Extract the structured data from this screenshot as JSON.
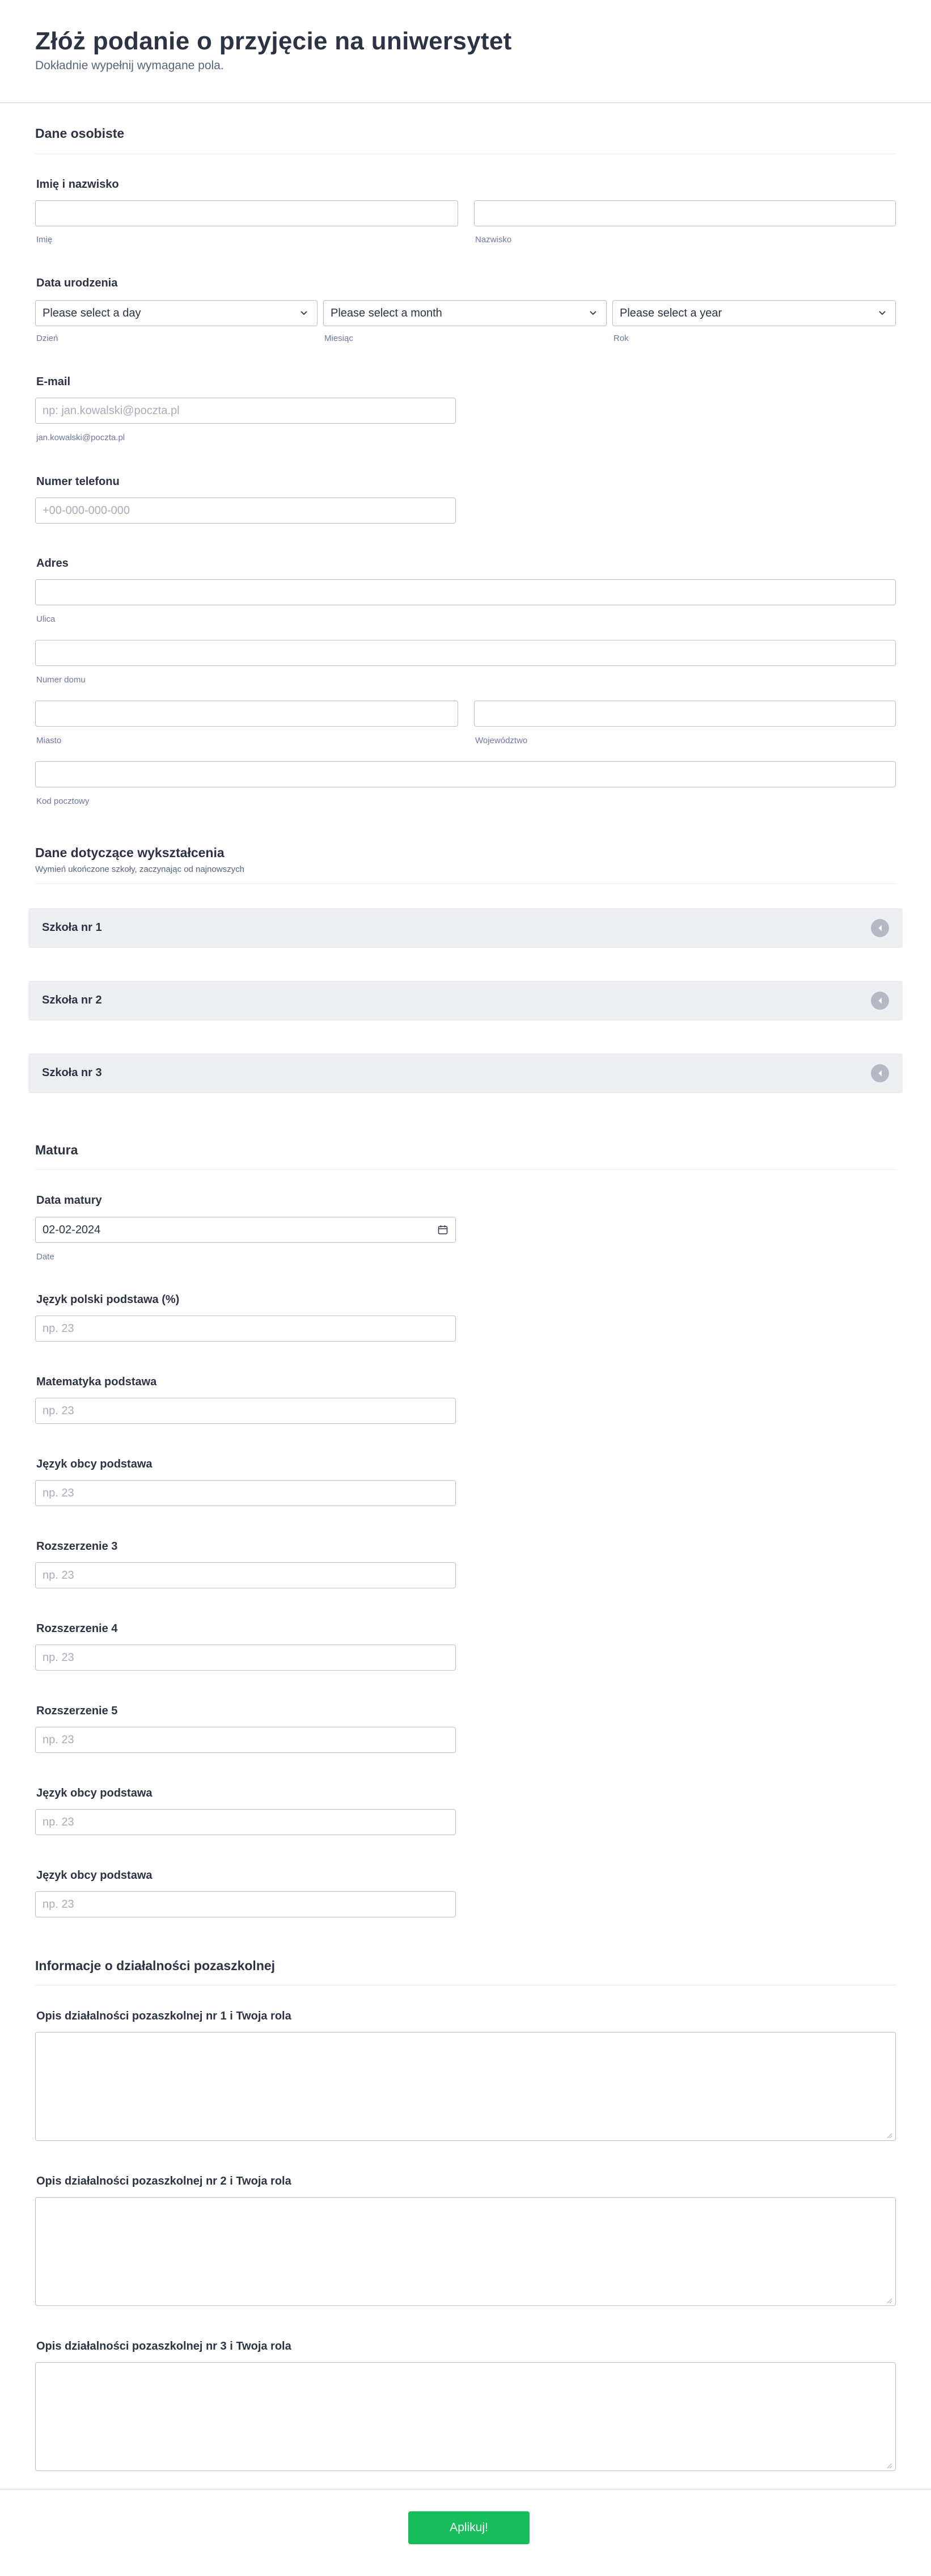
{
  "header": {
    "title": "Złóż podanie o przyjęcie na uniwersytet",
    "subtitle": "Dokładnie wypełnij wymagane pola."
  },
  "personal": {
    "title": "Dane osobiste",
    "name": {
      "label": "Imię i nazwisko",
      "first_sub": "Imię",
      "last_sub": "Nazwisko",
      "first_value": "",
      "last_value": ""
    },
    "birth": {
      "label": "Data urodzenia",
      "day_value": "Please select a day",
      "month_value": "Please select a month",
      "year_value": "Please select a year",
      "day_sub": "Dzień",
      "month_sub": "Miesiąc",
      "year_sub": "Rok"
    },
    "email": {
      "label": "E-mail",
      "placeholder": "np: jan.kowalski@poczta.pl",
      "sub": "jan.kowalski@poczta.pl"
    },
    "phone": {
      "label": "Numer telefonu",
      "placeholder": "+00-000-000-000"
    },
    "address": {
      "label": "Adres",
      "street_sub": "Ulica",
      "number_sub": "Numer domu",
      "city_sub": "Miasto",
      "region_sub": "Województwo",
      "zip_sub": "Kod pocztowy"
    }
  },
  "education": {
    "title": "Dane dotyczące wykształcenia",
    "subtitle": "Wymień ukończone szkoły, zaczynając od najnowszych",
    "schools": [
      "Szkoła nr 1",
      "Szkoła nr 2",
      "Szkoła nr 3"
    ]
  },
  "matura": {
    "title": "Matura",
    "date": {
      "label": "Data matury",
      "value": "02-02-2024",
      "sub": "Date"
    },
    "fields": [
      {
        "label": "Język polski podstawa (%)",
        "placeholder": "np. 23"
      },
      {
        "label": "Matematyka podstawa",
        "placeholder": "np. 23"
      },
      {
        "label": "Język obcy podstawa",
        "placeholder": "np. 23"
      },
      {
        "label": "Rozszerzenie 3",
        "placeholder": "np. 23"
      },
      {
        "label": "Rozszerzenie 4",
        "placeholder": "np. 23"
      },
      {
        "label": "Rozszerzenie 5",
        "placeholder": "np. 23"
      },
      {
        "label": "Język obcy podstawa",
        "placeholder": "np. 23"
      },
      {
        "label": "Język obcy podstawa",
        "placeholder": "np. 23"
      }
    ]
  },
  "extra": {
    "title": "Informacje o działalności pozaszkolnej",
    "fields": [
      {
        "label": "Opis działalności pozaszkolnej nr 1 i Twoja rola"
      },
      {
        "label": "Opis działalności pozaszkolnej nr 2 i Twoja rola"
      },
      {
        "label": "Opis działalności pozaszkolnej nr 3 i Twoja rola"
      }
    ]
  },
  "footer": {
    "submit_label": "Aplikuj!"
  },
  "colors": {
    "accent": "#18bd5b",
    "text": "#2c3345",
    "accordion_bg": "#eceef2"
  },
  "icons": [
    "chevron-down-icon",
    "calendar-icon",
    "collapse-arrow-icon",
    "resize-handle-icon"
  ]
}
